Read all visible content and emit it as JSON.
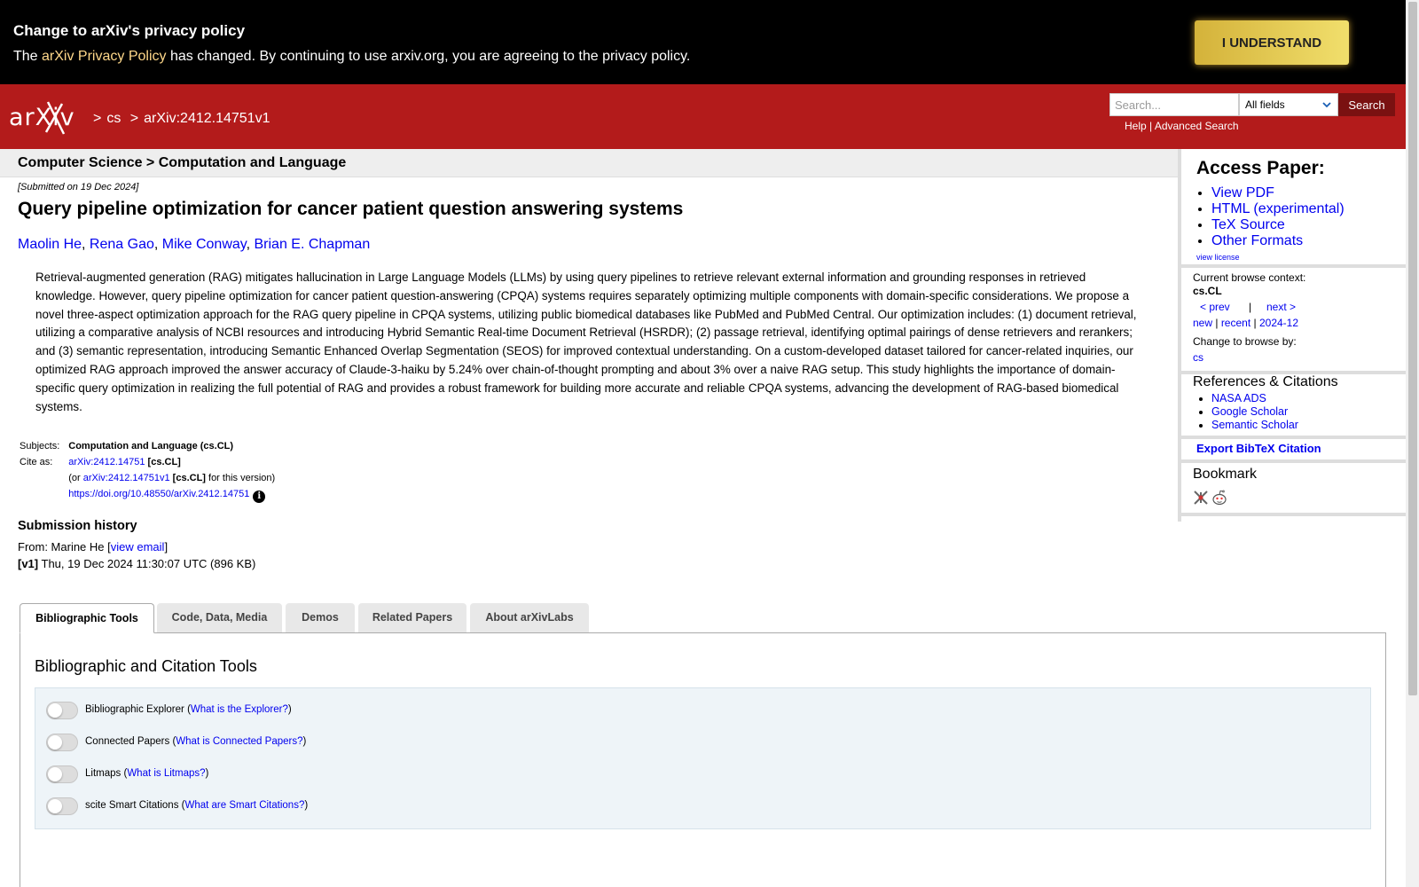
{
  "privacy_banner": {
    "title": "Change to arXiv's privacy policy",
    "text_prefix": "The ",
    "link": "arXiv Privacy Policy",
    "text_suffix": " has changed. By continuing to use arxiv.org, you are agreeing to the privacy policy.",
    "button": "I UNDERSTAND"
  },
  "header": {
    "logo_text": "arXiv",
    "breadcrumb": [
      ">",
      "cs",
      ">",
      "arXiv:2412.14751v1"
    ],
    "search_placeholder": "Search...",
    "search_field": "All fields",
    "search_button": "Search",
    "help": "Help",
    "sep": " | ",
    "advanced": "Advanced Search"
  },
  "subheader": "Computer Science > Computation and Language",
  "paper": {
    "submitted": "[Submitted on 19 Dec 2024]",
    "title": "Query pipeline optimization for cancer patient question answering systems",
    "authors": [
      "Maolin He",
      "Rena Gao",
      "Mike Conway",
      "Brian E. Chapman"
    ],
    "abstract": "Retrieval-augmented generation (RAG) mitigates hallucination in Large Language Models (LLMs) by using query pipelines to retrieve relevant external information and grounding responses in retrieved knowledge. However, query pipeline optimization for cancer patient question-answering (CPQA) systems requires separately optimizing multiple components with domain-specific considerations. We propose a novel three-aspect optimization approach for the RAG query pipeline in CPQA systems, utilizing public biomedical databases like PubMed and PubMed Central. Our optimization includes: (1) document retrieval, utilizing a comparative analysis of NCBI resources and introducing Hybrid Semantic Real-time Document Retrieval (HSRDR); (2) passage retrieval, identifying optimal pairings of dense retrievers and rerankers; and (3) semantic representation, introducing Semantic Enhanced Overlap Segmentation (SEOS) for improved contextual understanding. On a custom-developed dataset tailored for cancer-related inquiries, our optimized RAG approach improved the answer accuracy of Claude-3-haiku by 5.24% over chain-of-thought prompting and about 3% over a naive RAG setup. This study highlights the importance of domain-specific query optimization in realizing the full potential of RAG and provides a robust framework for building more accurate and reliable CPQA systems, advancing the development of RAG-based biomedical systems.",
    "subjects_label": "Subjects:",
    "subjects_value": "Computation and Language (cs.CL)",
    "cite_label": "Cite as:",
    "cite_link": "arXiv:2412.14751",
    "cite_cat": "[cs.CL]",
    "cite2_prefix": "(or ",
    "cite2_link": "arXiv:2412.14751v1",
    "cite2_cat": "[cs.CL]",
    "cite2_suffix": " for this version)",
    "doi": "https://doi.org/10.48550/arXiv.2412.14751",
    "info_icon": "i"
  },
  "history": {
    "heading": "Submission history",
    "from_prefix": "From: Marine He [",
    "view_email": "view email",
    "from_suffix": "]",
    "v1_label": "[v1]",
    "v1_text": " Thu, 19 Dec 2024 11:30:07 UTC (896 KB)"
  },
  "tabs": [
    "Bibliographic Tools",
    "Code, Data, Media",
    "Demos",
    "Related Papers",
    "About arXivLabs"
  ],
  "panel": {
    "title": "Bibliographic and Citation Tools",
    "tools": [
      {
        "label": "Bibliographic Explorer",
        "link": "What is the Explorer?"
      },
      {
        "label": "Connected Papers",
        "link": "What is Connected Papers?"
      },
      {
        "label": "Litmaps",
        "link": "What is Litmaps?"
      },
      {
        "label": "scite Smart Citations",
        "link": "What are Smart Citations?"
      }
    ]
  },
  "sidebar": {
    "access_title": "Access Paper:",
    "access_links": [
      "View PDF",
      "HTML (experimental)",
      "TeX Source",
      "Other Formats"
    ],
    "view_license": "view license",
    "browse_context_label": "Current browse context:",
    "browse_context": "cs.CL",
    "prev": "< prev",
    "pipe": "|",
    "next": "next >",
    "new": "new",
    "recent": "recent",
    "month": "2024-12",
    "change_browse": "Change to browse by:",
    "browse_cs": "cs",
    "refs_title": "References & Citations",
    "refs": [
      "NASA ADS",
      "Google Scholar",
      "Semantic Scholar"
    ],
    "export_bibtex": "Export BibTeX Citation",
    "bookmark_title": "Bookmark"
  }
}
